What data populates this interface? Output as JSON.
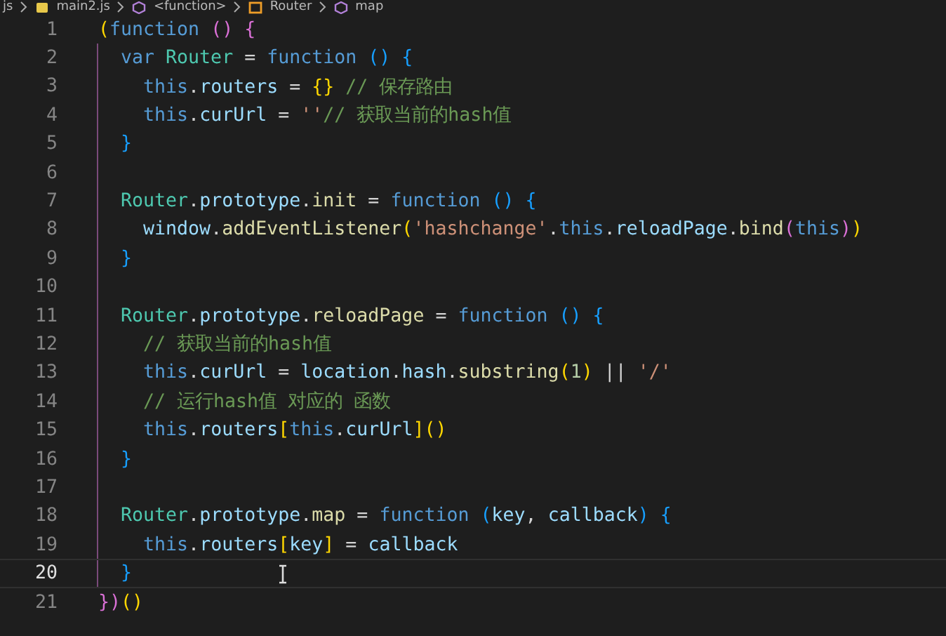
{
  "breadcrumb": [
    {
      "label": "js",
      "kind": "folder"
    },
    {
      "label": "main2.js",
      "kind": "file"
    },
    {
      "label": "<function>",
      "kind": "symbol"
    },
    {
      "label": "Router",
      "kind": "class"
    },
    {
      "label": "map",
      "kind": "symbol"
    }
  ],
  "editor": {
    "lines": [
      {
        "number": "1",
        "current": false,
        "tokens": [
          {
            "text": "(",
            "color": "#ffd700"
          },
          {
            "text": "function",
            "color": "#569cd6"
          },
          {
            "text": " ()",
            "color": "#da70d6"
          },
          {
            "text": " {",
            "color": "#da70d6"
          }
        ]
      },
      {
        "number": "2",
        "current": false,
        "tokens": [
          {
            "text": "  var",
            "color": "#569cd6"
          },
          {
            "text": " Router",
            "color": "#4ec9b0"
          },
          {
            "text": " = ",
            "color": "#d4d4d4"
          },
          {
            "text": "function",
            "color": "#569cd6"
          },
          {
            "text": " () {",
            "color": "#179fff"
          }
        ]
      },
      {
        "number": "3",
        "current": false,
        "tokens": [
          {
            "text": "    this",
            "color": "#569cd6"
          },
          {
            "text": ".",
            "color": "#d4d4d4"
          },
          {
            "text": "routers",
            "color": "#9cdcfe"
          },
          {
            "text": " = ",
            "color": "#d4d4d4"
          },
          {
            "text": "{}",
            "color": "#ffd700"
          },
          {
            "text": " // 保存路由",
            "color": "#6a9955"
          }
        ]
      },
      {
        "number": "4",
        "current": false,
        "tokens": [
          {
            "text": "    this",
            "color": "#569cd6"
          },
          {
            "text": ".",
            "color": "#d4d4d4"
          },
          {
            "text": "curUrl",
            "color": "#9cdcfe"
          },
          {
            "text": " = ",
            "color": "#d4d4d4"
          },
          {
            "text": "''",
            "color": "#ce9178"
          },
          {
            "text": "// 获取当前的hash值",
            "color": "#6a9955"
          }
        ]
      },
      {
        "number": "5",
        "current": false,
        "tokens": [
          {
            "text": "  }",
            "color": "#179fff"
          }
        ]
      },
      {
        "number": "6",
        "current": false
      },
      {
        "number": "7",
        "current": false,
        "tokens": [
          {
            "text": "  Router",
            "color": "#4ec9b0"
          },
          {
            "text": ".",
            "color": "#d4d4d4"
          },
          {
            "text": "prototype",
            "color": "#9cdcfe"
          },
          {
            "text": ".",
            "color": "#d4d4d4"
          },
          {
            "text": "init",
            "color": "#dcdcaa"
          },
          {
            "text": " = ",
            "color": "#d4d4d4"
          },
          {
            "text": "function",
            "color": "#569cd6"
          },
          {
            "text": " () {",
            "color": "#179fff"
          }
        ]
      },
      {
        "number": "8",
        "current": false,
        "tokens": [
          {
            "text": "    window",
            "color": "#9cdcfe"
          },
          {
            "text": ".",
            "color": "#d4d4d4"
          },
          {
            "text": "addEventListener",
            "color": "#dcdcaa"
          },
          {
            "text": "(",
            "color": "#ffd700"
          },
          {
            "text": "'hashchange'",
            "color": "#ce9178"
          },
          {
            "text": ".",
            "color": "#d4d4d4"
          },
          {
            "text": "this",
            "color": "#569cd6"
          },
          {
            "text": ".",
            "color": "#d4d4d4"
          },
          {
            "text": "reloadPage",
            "color": "#9cdcfe"
          },
          {
            "text": ".",
            "color": "#d4d4d4"
          },
          {
            "text": "bind",
            "color": "#dcdcaa"
          },
          {
            "text": "(",
            "color": "#da70d6"
          },
          {
            "text": "this",
            "color": "#569cd6"
          },
          {
            "text": ")",
            "color": "#da70d6"
          },
          {
            "text": ")",
            "color": "#ffd700"
          }
        ]
      },
      {
        "number": "9",
        "current": false,
        "tokens": [
          {
            "text": "  }",
            "color": "#179fff"
          }
        ]
      },
      {
        "number": "10",
        "current": false
      },
      {
        "number": "11",
        "current": false,
        "tokens": [
          {
            "text": "  Router",
            "color": "#4ec9b0"
          },
          {
            "text": ".",
            "color": "#d4d4d4"
          },
          {
            "text": "prototype",
            "color": "#9cdcfe"
          },
          {
            "text": ".",
            "color": "#d4d4d4"
          },
          {
            "text": "reloadPage",
            "color": "#dcdcaa"
          },
          {
            "text": " = ",
            "color": "#d4d4d4"
          },
          {
            "text": "function",
            "color": "#569cd6"
          },
          {
            "text": " () {",
            "color": "#179fff"
          }
        ]
      },
      {
        "number": "12",
        "current": false,
        "tokens": [
          {
            "text": "    // 获取当前的hash值",
            "color": "#6a9955"
          }
        ]
      },
      {
        "number": "13",
        "current": false,
        "tokens": [
          {
            "text": "    this",
            "color": "#569cd6"
          },
          {
            "text": ".",
            "color": "#d4d4d4"
          },
          {
            "text": "curUrl",
            "color": "#9cdcfe"
          },
          {
            "text": " = ",
            "color": "#d4d4d4"
          },
          {
            "text": "location",
            "color": "#9cdcfe"
          },
          {
            "text": ".",
            "color": "#d4d4d4"
          },
          {
            "text": "hash",
            "color": "#9cdcfe"
          },
          {
            "text": ".",
            "color": "#d4d4d4"
          },
          {
            "text": "substring",
            "color": "#dcdcaa"
          },
          {
            "text": "(",
            "color": "#ffd700"
          },
          {
            "text": "1",
            "color": "#b5cea8"
          },
          {
            "text": ")",
            "color": "#ffd700"
          },
          {
            "text": " || ",
            "color": "#d4d4d4"
          },
          {
            "text": "'/'",
            "color": "#ce9178"
          }
        ]
      },
      {
        "number": "14",
        "current": false,
        "tokens": [
          {
            "text": "    // 运行hash值 对应的 函数",
            "color": "#6a9955"
          }
        ]
      },
      {
        "number": "15",
        "current": false,
        "tokens": [
          {
            "text": "    this",
            "color": "#569cd6"
          },
          {
            "text": ".",
            "color": "#d4d4d4"
          },
          {
            "text": "routers",
            "color": "#9cdcfe"
          },
          {
            "text": "[",
            "color": "#ffd700"
          },
          {
            "text": "this",
            "color": "#569cd6"
          },
          {
            "text": ".",
            "color": "#d4d4d4"
          },
          {
            "text": "curUrl",
            "color": "#9cdcfe"
          },
          {
            "text": "]()",
            "color": "#ffd700"
          }
        ]
      },
      {
        "number": "16",
        "current": false,
        "tokens": [
          {
            "text": "  }",
            "color": "#179fff"
          }
        ]
      },
      {
        "number": "17",
        "current": false
      },
      {
        "number": "18",
        "current": false,
        "tokens": [
          {
            "text": "  Router",
            "color": "#4ec9b0"
          },
          {
            "text": ".",
            "color": "#d4d4d4"
          },
          {
            "text": "prototype",
            "color": "#9cdcfe"
          },
          {
            "text": ".",
            "color": "#d4d4d4"
          },
          {
            "text": "map",
            "color": "#dcdcaa"
          },
          {
            "text": " = ",
            "color": "#d4d4d4"
          },
          {
            "text": "function",
            "color": "#569cd6"
          },
          {
            "text": " (",
            "color": "#179fff"
          },
          {
            "text": "key",
            "color": "#9cdcfe"
          },
          {
            "text": ", ",
            "color": "#d4d4d4"
          },
          {
            "text": "callback",
            "color": "#9cdcfe"
          },
          {
            "text": ") {",
            "color": "#179fff"
          }
        ]
      },
      {
        "number": "19",
        "current": false,
        "tokens": [
          {
            "text": "    this",
            "color": "#569cd6"
          },
          {
            "text": ".",
            "color": "#d4d4d4"
          },
          {
            "text": "routers",
            "color": "#9cdcfe"
          },
          {
            "text": "[",
            "color": "#ffd700"
          },
          {
            "text": "key",
            "color": "#9cdcfe"
          },
          {
            "text": "]",
            "color": "#ffd700"
          },
          {
            "text": " = ",
            "color": "#d4d4d4"
          },
          {
            "text": "callback",
            "color": "#9cdcfe"
          }
        ]
      },
      {
        "number": "20",
        "current": true,
        "tokens": [
          {
            "text": "  }",
            "color": "#179fff"
          }
        ]
      },
      {
        "number": "21",
        "current": false,
        "tokens": [
          {
            "text": "})",
            "color": "#da70d6"
          },
          {
            "text": "()",
            "color": "#ffd700"
          }
        ]
      }
    ]
  }
}
